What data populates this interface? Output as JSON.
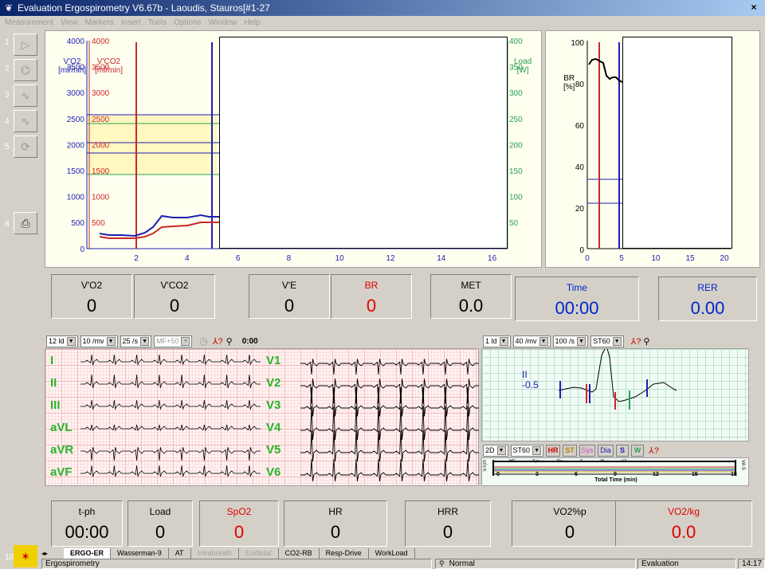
{
  "window": {
    "title": "Evaluation Ergospirometry  V6.67b - Laoudis, Stauros[#1-27",
    "close": "×"
  },
  "menu": [
    "Measurement",
    "View",
    "Markers",
    "Insert",
    "Tools",
    "Options",
    "Window",
    "Help"
  ],
  "toolbar": {
    "numbers": [
      "1",
      "2",
      "3",
      "4",
      "5",
      "8"
    ],
    "bottom_number": "10"
  },
  "main_chart": {
    "left_axis_1": {
      "label_line1": "V'O2",
      "label_line2": "[ml/min]",
      "ticks": [
        "4000",
        "3500",
        "3000",
        "2500",
        "2000",
        "1500",
        "1000",
        "500",
        "0"
      ]
    },
    "left_axis_2": {
      "label_line1": "V'CO2",
      "label_line2": "[ml/min]",
      "ticks": [
        "4000",
        "3500",
        "3000",
        "2500",
        "2000",
        "1500",
        "1000",
        "500",
        "0"
      ]
    },
    "right_axis": {
      "label_line1": "Load",
      "label_line2": "[W]",
      "ticks": [
        "400",
        "350",
        "300",
        "250",
        "200",
        "150",
        "100",
        "50"
      ]
    },
    "x_ticks": [
      "2",
      "4",
      "6",
      "8",
      "10",
      "12",
      "14",
      "16"
    ]
  },
  "br_chart": {
    "y_label_line1": "BR",
    "y_label_line2": "[%]",
    "y_ticks": [
      "100",
      "80",
      "60",
      "40",
      "20",
      "0"
    ],
    "x_ticks": [
      "0",
      "5",
      "10",
      "15",
      "20"
    ]
  },
  "values_top": [
    {
      "label": "V'O2",
      "value": "0",
      "label_color": "#000000",
      "value_color": "#000000"
    },
    {
      "label": "V'CO2",
      "value": "0",
      "label_color": "#000000",
      "value_color": "#000000"
    },
    {
      "label": "V'E",
      "value": "0",
      "label_color": "#000000",
      "value_color": "#000000"
    },
    {
      "label": "BR",
      "value": "0",
      "label_color": "#e00000",
      "value_color": "#e00000"
    },
    {
      "label": "MET",
      "value": "0.0",
      "label_color": "#000000",
      "value_color": "#000000"
    },
    {
      "label": "Time",
      "value": "00:00",
      "label_color": "#0026c8",
      "value_color": "#0026c8"
    },
    {
      "label": "RER",
      "value": "0.00",
      "label_color": "#0026c8",
      "value_color": "#0026c8"
    }
  ],
  "ecg": {
    "toolbar": {
      "leads": "12 ld",
      "gain": "10 /mv",
      "speed": "25 /s",
      "filter": "MF+50",
      "time": "0:00"
    },
    "lead_labels_left": [
      "I",
      "II",
      "III",
      "aVL",
      "aVR",
      "aVF"
    ],
    "lead_labels_right": [
      "V1",
      "V2",
      "V3",
      "V4",
      "V5",
      "V6"
    ],
    "beat_toolbar": {
      "leads": "1 ld",
      "gain": "40 /mv",
      "speed": "100 /s",
      "st": "ST60"
    },
    "beat_lead": "II",
    "beat_value": "-0.5",
    "trend_toolbar": {
      "mode": "2D",
      "st": "ST60",
      "buttons": [
        "HR",
        "ST",
        "Sys",
        "Dia",
        "S",
        "W"
      ]
    },
    "trend_legend": [
      "HR",
      "Sys",
      "Dia",
      "S",
      "W",
      "V2"
    ],
    "trend_x_ticks": [
      "0",
      "3",
      "6",
      "9",
      "12",
      "15",
      "18"
    ],
    "trend_x_label": "Total Time (min)",
    "trend_left_label": "ST(m",
    "trend_right_label": "VA S"
  },
  "values_bottom": [
    {
      "label": "t-ph",
      "value": "00:00",
      "label_color": "#000000",
      "value_color": "#000000"
    },
    {
      "label": "Load",
      "value": "0",
      "label_color": "#000000",
      "value_color": "#000000"
    },
    {
      "label": "SpO2",
      "value": "0",
      "label_color": "#e00000",
      "value_color": "#e00000"
    },
    {
      "label": "HR",
      "value": "0",
      "label_color": "#000000",
      "value_color": "#000000"
    },
    {
      "label": "HRR",
      "value": "0",
      "label_color": "#000000",
      "value_color": "#000000"
    },
    {
      "label": "VO2%p",
      "value": "0",
      "label_color": "#000000",
      "value_color": "#000000"
    },
    {
      "label": "VO2/kg",
      "value": "0.0",
      "label_color": "#e00000",
      "value_color": "#e00000"
    }
  ],
  "tabs": [
    {
      "label": "ERGO-ER",
      "active": true,
      "disabled": false
    },
    {
      "label": "Wasserman-9",
      "active": false,
      "disabled": false
    },
    {
      "label": "AT",
      "active": false,
      "disabled": false
    },
    {
      "label": "Intrabreath",
      "active": false,
      "disabled": true
    },
    {
      "label": "Endtidal",
      "active": false,
      "disabled": true
    },
    {
      "label": "CO2-RB",
      "active": false,
      "disabled": false
    },
    {
      "label": "Resp-Drive",
      "active": false,
      "disabled": false
    },
    {
      "label": "WorkLoad",
      "active": false,
      "disabled": false
    }
  ],
  "status": {
    "left": "Ergospirometry",
    "mid": "Normal",
    "right": "Evaluation",
    "time": "14:17"
  },
  "colors": {
    "vo2": "#1e1eb4",
    "vco2": "#c82828",
    "load": "#28a050",
    "accent_blue": "#0026c8",
    "alert_red": "#e00000"
  }
}
